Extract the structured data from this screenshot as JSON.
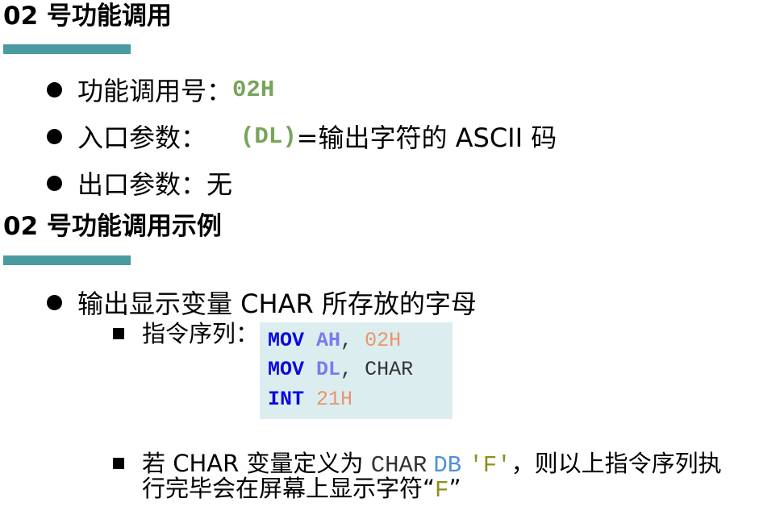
{
  "section1": {
    "title": "02 号功能调用",
    "bullets": [
      {
        "label": "功能调用号：",
        "code": "02H"
      },
      {
        "label": "入口参数：",
        "code": "(DL)",
        "tail": "=输出字符的 ASCII 码"
      },
      {
        "label": "出口参数：无"
      }
    ]
  },
  "section2": {
    "title": "02 号功能调用示例",
    "bullet": "输出显示变量 CHAR 所存放的字母",
    "sub1_label": "指令序列：",
    "code": [
      {
        "op": "MOV",
        "reg": "AH",
        "comma": ",",
        "arg": "02H"
      },
      {
        "op": "MOV",
        "reg": "DL",
        "comma": ",",
        "arg": "CHAR"
      },
      {
        "op": "INT",
        "arg": "21H"
      }
    ],
    "sub2": {
      "prefix": "若 CHAR 变量定义为",
      "var": "CHAR",
      "directive": "DB",
      "literal": "'F'",
      "mid": "，则以上指令序列执",
      "line2": "行完毕会在屏幕上显示字符",
      "open_quote": "“",
      "char": "F",
      "close_quote": "”"
    }
  },
  "colors": {
    "heading_bar": "#4a9aa2",
    "code_bg": "#dcedef",
    "keyword": "#0a0ae0",
    "register": "#7b7bea",
    "number": "#e8956a",
    "green_code": "#78a45a"
  }
}
